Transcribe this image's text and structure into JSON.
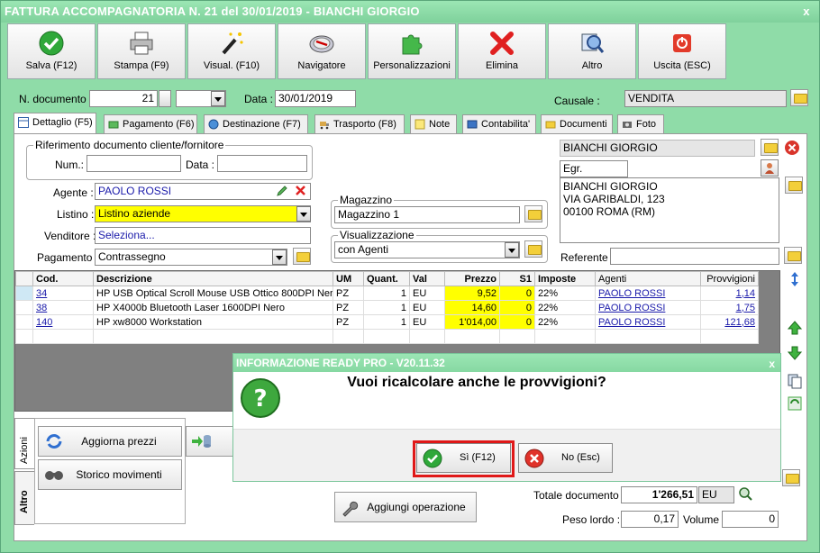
{
  "window": {
    "title": "FATTURA ACCOMPAGNATORIA N. 21 del 30/01/2019 - BIANCHI GIORGIO",
    "close": "x"
  },
  "toolbar": [
    {
      "label": "Salva (F12)",
      "icon": "check-icon"
    },
    {
      "label": "Stampa (F9)",
      "icon": "printer-icon"
    },
    {
      "label": "Visual. (F10)",
      "icon": "magic-wand-icon"
    },
    {
      "label": "Navigatore",
      "icon": "compass-icon"
    },
    {
      "label": "Personalizzazioni",
      "icon": "puzzle-icon"
    },
    {
      "label": "Elimina",
      "icon": "delete-x-icon"
    },
    {
      "label": "Altro",
      "icon": "magnifier-icon"
    },
    {
      "label": "Uscita (ESC)",
      "icon": "power-icon"
    }
  ],
  "header": {
    "n_documento_label": "N. documento :",
    "n_documento_value": "21",
    "data_label": "Data :",
    "data_value": "30/01/2019",
    "causale_label": "Causale :",
    "causale_value": "VENDITA"
  },
  "tabs": [
    {
      "label": "Dettaglio (F5)",
      "active": true
    },
    {
      "label": "Pagamento (F6)"
    },
    {
      "label": "Destinazione (F7)"
    },
    {
      "label": "Trasporto (F8)"
    },
    {
      "label": "Note"
    },
    {
      "label": "Contabilita'"
    },
    {
      "label": "Documenti"
    },
    {
      "label": "Foto"
    }
  ],
  "riferimento": {
    "title": "Riferimento documento cliente/fornitore",
    "num_label": "Num.:",
    "num_value": "",
    "data_label": "Data :",
    "data_value": ""
  },
  "form": {
    "agente_label": "Agente :",
    "agente_value": "PAOLO ROSSI",
    "listino_label": "Listino :",
    "listino_value": "Listino aziende",
    "venditore_label": "Venditore :",
    "venditore_value": "Seleziona...",
    "pagamento_label": "Pagamento :",
    "pagamento_value": "Contrassegno"
  },
  "magazzino": {
    "title": "Magazzino",
    "value": "Magazzino 1"
  },
  "visualizzazione": {
    "title": "Visualizzazione",
    "value": "con Agenti"
  },
  "cliente": {
    "name": "BIANCHI GIORGIO",
    "prefix": "Egr.",
    "address_lines": [
      "BIANCHI GIORGIO",
      "VIA GARIBALDI, 123",
      "00100 ROMA (RM)"
    ],
    "referente_label": "Referente",
    "referente_value": ""
  },
  "grid": {
    "columns": [
      "Cod.",
      "Descrizione",
      "UM",
      "Quant.",
      "Val",
      "Prezzo",
      "S1",
      "Imposte",
      "Agenti",
      "Provvigioni"
    ],
    "rows": [
      {
        "cod": "34",
        "descrizione": "HP USB Optical Scroll Mouse USB Ottico 800DPI Ner…",
        "um": "PZ",
        "quant": "1",
        "val": "EU",
        "prezzo": "9,52",
        "s1": "0",
        "imposte": "22%",
        "agenti": "PAOLO ROSSI",
        "provvigioni": "1,14"
      },
      {
        "cod": "38",
        "descrizione": "HP X4000b Bluetooth Laser 1600DPI Nero",
        "um": "PZ",
        "quant": "1",
        "val": "EU",
        "prezzo": "14,60",
        "s1": "0",
        "imposte": "22%",
        "agenti": "PAOLO ROSSI",
        "provvigioni": "1,75"
      },
      {
        "cod": "140",
        "descrizione": "HP xw8000 Workstation",
        "um": "PZ",
        "quant": "1",
        "val": "EU",
        "prezzo": "1'014,00",
        "s1": "0",
        "imposte": "22%",
        "agenti": "PAOLO ROSSI",
        "provvigioni": "121,68"
      }
    ]
  },
  "side_tabs": {
    "azioni": "Azioni",
    "altro": "Altro"
  },
  "actions": {
    "aggiorna_prezzi": "Aggiorna prezzi",
    "storico_movimenti": "Storico movimenti",
    "aggiungi_operazione": "Aggiungi operazione"
  },
  "totals": {
    "totale_label": "Totale documento :",
    "totale_value": "1'266,51",
    "totale_currency": "EU",
    "peso_label": "Peso lordo :",
    "peso_value": "0,17",
    "volume_label": "Volume :",
    "volume_value": "0"
  },
  "dialog": {
    "title": "INFORMAZIONE READY PRO - V20.11.32",
    "close": "x",
    "message": "Vuoi ricalcolare anche le provvigioni?",
    "yes_label": "Sì (F12)",
    "no_label": "No (Esc)"
  }
}
